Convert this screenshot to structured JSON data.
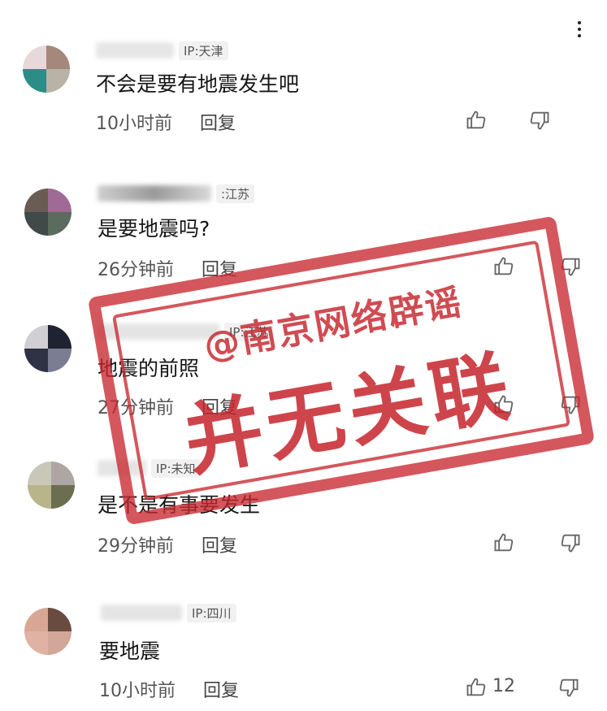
{
  "comments": [
    {
      "ip": "IP:天津",
      "text": "不会是要有地震发生吧",
      "time": "10小时前",
      "reply": "回复",
      "avatar_colors": [
        "#e7d9da",
        "#a5877c",
        "#2c8c88",
        "#b8b3a6"
      ]
    },
    {
      "ip": ":江苏",
      "text": "是要地震吗?",
      "time": "26分钟前",
      "reply": "回复",
      "avatar_colors": [
        "#6a5b53",
        "#a06a96",
        "#3f4a49",
        "#5b6b5d"
      ]
    },
    {
      "ip": "IP:江苏",
      "text": "地震的前照",
      "time": "27分钟前",
      "reply": "回复",
      "avatar_colors": [
        "#cfcfd4",
        "#1f2230",
        "#2f3144",
        "#7b7d92"
      ]
    },
    {
      "ip": "IP:未知",
      "text": "是不是有事要发生",
      "time": "29分钟前",
      "reply": "回复",
      "avatar_colors": [
        "#c9c7b8",
        "#ada6a3",
        "#b8b58a",
        "#6b6e4f"
      ]
    },
    {
      "ip": "IP:四川",
      "text": "要地震",
      "time": "10小时前",
      "reply": "回复",
      "like_count": "12",
      "avatar_colors": [
        "#d8a693",
        "#6a4b3f",
        "#e0b2a3",
        "#d3a69a"
      ]
    }
  ],
  "stamp": {
    "top_text": "@南京网络辟谣",
    "main_text": "并无关联",
    "color": "#c4242c"
  },
  "icons": {
    "like": "thumbs-up-icon",
    "dislike": "thumbs-down-icon",
    "more": "more-vertical-icon"
  }
}
